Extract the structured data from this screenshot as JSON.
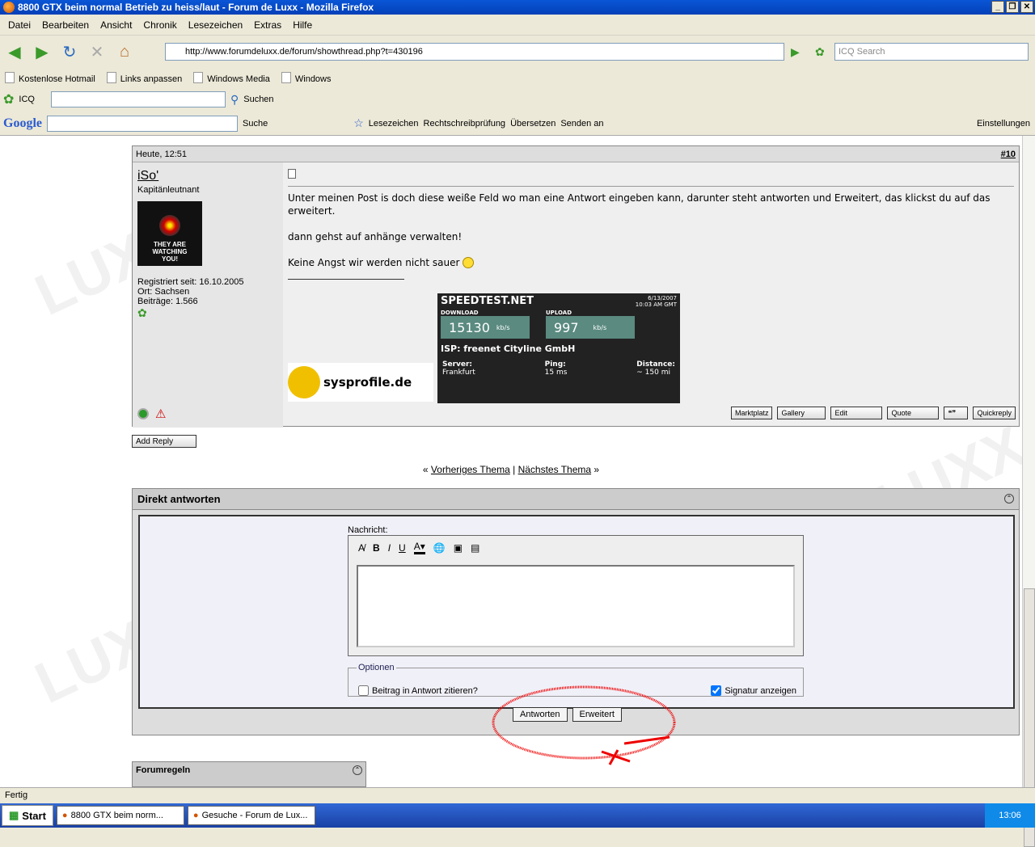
{
  "window": {
    "title": "8800 GTX beim normal Betrieb zu heiss/laut - Forum de Luxx - Mozilla Firefox"
  },
  "menu": [
    "Datei",
    "Bearbeiten",
    "Ansicht",
    "Chronik",
    "Lesezeichen",
    "Extras",
    "Hilfe"
  ],
  "nav": {
    "url": "http://www.forumdeluxx.de/forum/showthread.php?t=430196",
    "search_placeholder": "ICQ Search"
  },
  "bookmarks": [
    "Kostenlose Hotmail",
    "Links anpassen",
    "Windows Media",
    "Windows"
  ],
  "icq": {
    "label": "ICQ",
    "search": "Suchen"
  },
  "google": {
    "logo": "Google",
    "search": "Suche",
    "lesezeichen": "Lesezeichen",
    "rechtschreib": "Rechtschreibprüfung",
    "uebersetzen": "Übersetzen",
    "senden": "Senden an",
    "einstellungen": "Einstellungen"
  },
  "post": {
    "date": "Heute, 12:51",
    "number": "#10",
    "username": "iSo'",
    "rank": "Kapitänleutnant",
    "avatar_text": "THEY ARE WATCHING YOU!",
    "registered": "Registriert seit: 16.10.2005",
    "location": "Ort: Sachsen",
    "posts": "Beiträge: 1.566",
    "body1": "Unter meinen Post is doch diese weiße Feld wo man eine Antwort eingeben kann, darunter steht antworten und Erweitert, das klickst du auf das erweitert.",
    "body2": "dann gehst auf anhänge verwalten!",
    "body3": "Keine Angst wir werden nicht sauer",
    "sysprofile": "sysprofile.de",
    "speedtest": {
      "brand": "SPEEDTEST.NET",
      "date": "6/13/2007",
      "time": "10:03 AM GMT",
      "download_label": "DOWNLOAD",
      "download": "15130",
      "upload_label": "UPLOAD",
      "upload": "997",
      "unit": "kb/s",
      "isp": "ISP:  freenet Cityline GmbH",
      "server_label": "Server:",
      "server": "Frankfurt",
      "ping_label": "Ping:",
      "ping": "15 ms",
      "distance_label": "Distance:",
      "distance": "~ 150 mi"
    },
    "buttons": [
      "Marktplatz",
      "Gallery",
      "Edit",
      "Quote",
      "Quickreply"
    ]
  },
  "add_reply": "Add Reply",
  "thread_nav": {
    "prev": "Vorheriges Thema",
    "next": "Nächstes Thema"
  },
  "reply": {
    "title": "Direkt antworten",
    "message_label": "Nachricht:",
    "options_label": "Optionen",
    "quote_label": "Beitrag in Antwort zitieren?",
    "signature_label": "Signatur anzeigen",
    "submit": "Antworten",
    "advanced": "Erweitert"
  },
  "rules": {
    "title": "Forumregeln"
  },
  "status": "Fertig",
  "taskbar": {
    "start": "Start",
    "task1": "8800 GTX beim norm...",
    "task2": "Gesuche - Forum de Lux...",
    "clock": "13:06"
  }
}
